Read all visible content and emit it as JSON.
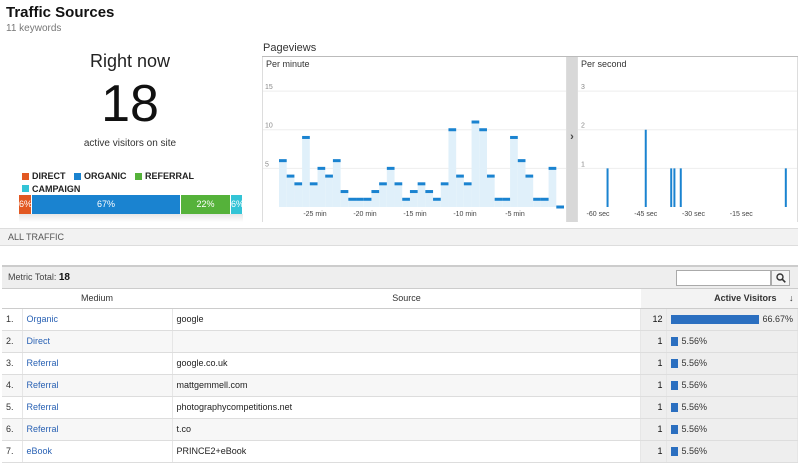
{
  "page": {
    "title": "Traffic Sources",
    "subtitle": "11 keywords"
  },
  "right_now": {
    "heading": "Right now",
    "count": "18",
    "caption": "active visitors on site"
  },
  "legend": [
    {
      "label": "DIRECT",
      "color": "#e25822"
    },
    {
      "label": "ORGANIC",
      "color": "#1a83d0"
    },
    {
      "label": "REFERRAL",
      "color": "#55b23a"
    },
    {
      "label": "CAMPAIGN",
      "color": "#33c4d6"
    }
  ],
  "share_bar": [
    {
      "label": "6%",
      "value": 6,
      "color": "#e25822"
    },
    {
      "label": "67%",
      "value": 67,
      "color": "#1a83d0"
    },
    {
      "label": "22%",
      "value": 22,
      "color": "#55b23a"
    },
    {
      "label": "6%",
      "value": 6,
      "color": "#33c4d6"
    }
  ],
  "pageviews": {
    "title": "Pageviews",
    "expand_glyph": "›",
    "per_minute": {
      "label": "Per minute",
      "y_ticks": [
        "15",
        "10",
        "5"
      ],
      "ylim": [
        0,
        15
      ],
      "x_ticks": [
        "-25 min",
        "-20 min",
        "-15 min",
        "-10 min",
        "-5 min"
      ],
      "values": [
        6,
        4,
        3,
        9,
        3,
        5,
        4,
        6,
        2,
        1,
        1,
        1,
        2,
        3,
        5,
        3,
        1,
        2,
        3,
        2,
        1,
        3,
        10,
        4,
        3,
        11,
        10,
        4,
        1,
        1,
        9,
        6,
        4,
        1,
        1,
        5,
        0
      ],
      "color": "#1a83d0"
    },
    "per_second": {
      "label": "Per second",
      "y_ticks": [
        "3",
        "2",
        "1"
      ],
      "ylim": [
        0,
        3
      ],
      "x_ticks": [
        "-60 sec",
        "-45 sec",
        "-30 sec",
        "-15 sec"
      ],
      "spikes": [
        {
          "t": -57,
          "v": 1
        },
        {
          "t": -45,
          "v": 2
        },
        {
          "t": -37,
          "v": 1
        },
        {
          "t": -36,
          "v": 1
        },
        {
          "t": -34,
          "v": 1
        },
        {
          "t": -1,
          "v": 1
        }
      ],
      "color": "#1a83d0"
    }
  },
  "all_traffic_label": "ALL TRAFFIC",
  "table": {
    "metric_total_label": "Metric Total:",
    "metric_total_value": "18",
    "search_placeholder": "",
    "search_icon": "magnifier-icon",
    "columns": [
      "Medium",
      "Source",
      "Active Visitors"
    ],
    "sort_arrow": "↓",
    "rows": [
      {
        "num": "1.",
        "medium": "Organic",
        "source": "google",
        "value": "12",
        "pct": "66.67%",
        "share": 0.6667
      },
      {
        "num": "2.",
        "medium": "Direct",
        "source": "",
        "value": "1",
        "pct": "5.56%",
        "share": 0.0556
      },
      {
        "num": "3.",
        "medium": "Referral",
        "source": "google.co.uk",
        "value": "1",
        "pct": "5.56%",
        "share": 0.0556
      },
      {
        "num": "4.",
        "medium": "Referral",
        "source": "mattgemmell.com",
        "value": "1",
        "pct": "5.56%",
        "share": 0.0556
      },
      {
        "num": "5.",
        "medium": "Referral",
        "source": "photographycompetitions.net",
        "value": "1",
        "pct": "5.56%",
        "share": 0.0556
      },
      {
        "num": "6.",
        "medium": "Referral",
        "source": "t.co",
        "value": "1",
        "pct": "5.56%",
        "share": 0.0556
      },
      {
        "num": "7.",
        "medium": "eBook",
        "source": "PRINCE2+eBook",
        "value": "1",
        "pct": "5.56%",
        "share": 0.0556
      }
    ]
  }
}
